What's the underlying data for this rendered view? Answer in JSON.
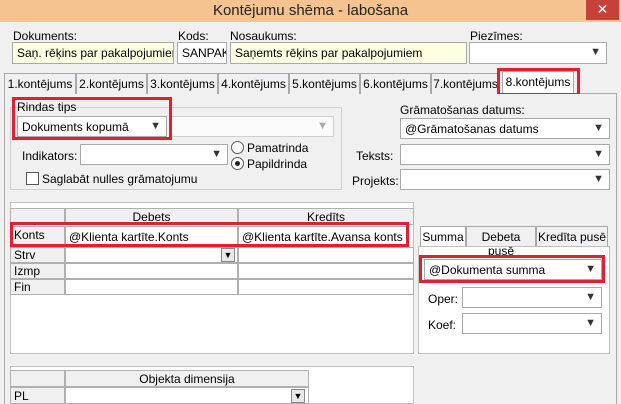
{
  "window": {
    "title": "Kontējumu shēma - labošana",
    "close_glyph": "✕"
  },
  "header": {
    "dokuments_label": "Dokuments:",
    "dokuments_value": "Saņ. rēķins par pakalpojumiem",
    "kods_label": "Kods:",
    "kods_value": "SANPAK",
    "nosaukums_label": "Nosaukums:",
    "nosaukums_value": "Saņemts rēķins par pakalpojumiem",
    "piezimes_label": "Piezīmes:",
    "piezimes_value": ""
  },
  "tabs": [
    "1.kontējums",
    "2.kontējums",
    "3.kontējums",
    "4.kontējums",
    "5.kontējums",
    "6.kontējums",
    "7.kontējums",
    "8.kontējums"
  ],
  "active_tab": "8.kontējums",
  "rindas_tips": {
    "label": "Rindas tips",
    "value": "Dokuments kopumā",
    "secondary_value": ""
  },
  "indikators": {
    "label": "Indikators:",
    "value": ""
  },
  "radios": {
    "pamatrinda": "Pamatrinda",
    "papildrinda": "Papildrinda",
    "selected": "Papildrinda"
  },
  "saglabat_nulles": {
    "label": "Saglabāt nulles grāmatojumu",
    "checked": false
  },
  "right_fields": {
    "gramatosanas_label": "Grāmatošanas datums:",
    "gramatosanas_value": "@Grāmatošanas datums",
    "teksts_label": "Teksts:",
    "teksts_value": "",
    "projekts_label": "Projekts:",
    "projekts_value": ""
  },
  "grid": {
    "debets_header": "Debets",
    "kredits_header": "Kredīts",
    "rows": [
      {
        "label": "Konts",
        "debets": "@Klienta kartīte.Konts",
        "kredits": "@Klienta kartīte.Avansa konts"
      },
      {
        "label": "Strv",
        "debets": "",
        "kredits": ""
      },
      {
        "label": "Izmp",
        "debets": "",
        "kredits": ""
      },
      {
        "label": "Fin",
        "debets": "",
        "kredits": ""
      }
    ],
    "dropdown_glyph": "▼"
  },
  "summa_tabs": [
    "Summa",
    "Debeta pusē",
    "Kredīta pusē"
  ],
  "summa": {
    "value": "@Dokumenta summa",
    "oper_label": "Oper:",
    "oper_value": "",
    "koef_label": "Koef:",
    "koef_value": ""
  },
  "objekta_dimensija": {
    "header": "Objekta dimensija",
    "row_label": "PL",
    "row_value": ""
  },
  "icons": {
    "combo_arrow": "chevron-down-icon"
  }
}
